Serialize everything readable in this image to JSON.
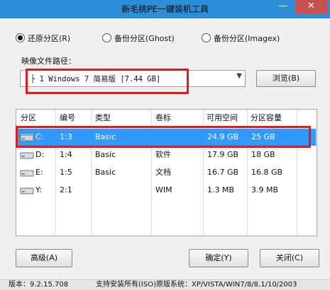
{
  "window": {
    "title": "新毛桃PE一键装机工具",
    "minimize_glyph": "—",
    "close_glyph": "✕"
  },
  "mode": {
    "options": [
      {
        "label": "还原分区(R)",
        "selected": true
      },
      {
        "label": "备份分区(Ghost)",
        "selected": false
      },
      {
        "label": "备份分区(Imagex)",
        "selected": false
      }
    ]
  },
  "image": {
    "label": "映像文件路径：",
    "selected": "├ 1 Windows 7 简易版 [7.44 GB]",
    "browse_label": "浏览(B)"
  },
  "table": {
    "columns": [
      "分区",
      "编号",
      "类型",
      "卷标",
      "可用空间",
      "分区容量"
    ],
    "rows": [
      {
        "drive": "C:",
        "number": "1:3",
        "type": "Basic",
        "label": "",
        "free": "24.9 GB",
        "size": "25 GB",
        "selected": true
      },
      {
        "drive": "D:",
        "number": "1:4",
        "type": "Basic",
        "label": "软件",
        "free": "17.9 GB",
        "size": "18 GB",
        "selected": false
      },
      {
        "drive": "E:",
        "number": "1:5",
        "type": "Basic",
        "label": "文档",
        "free": "16.7 GB",
        "size": "16.8 GB",
        "selected": false
      },
      {
        "drive": "Y:",
        "number": "2:1",
        "type": "",
        "label": "WIM",
        "free": "1.3 MB",
        "size": "3.9 MB",
        "selected": false
      }
    ]
  },
  "buttons": {
    "advanced": "高级(A)",
    "ok": "确定(Y)",
    "close": "关闭(C)"
  },
  "status": {
    "version": "版本：9.2.15.708",
    "support": "支持安装所有(ISO)原版系统：XP/VISTA/WIN7/8/8.1/10/2003"
  },
  "colors": {
    "title_bar": "#2a8fd8",
    "close_button": "#c75050",
    "selection": "#3399ff",
    "highlight_box": "#e11a1a"
  },
  "icons": {
    "drive": "drive-icon",
    "dropdown": "chevron-down-icon"
  }
}
